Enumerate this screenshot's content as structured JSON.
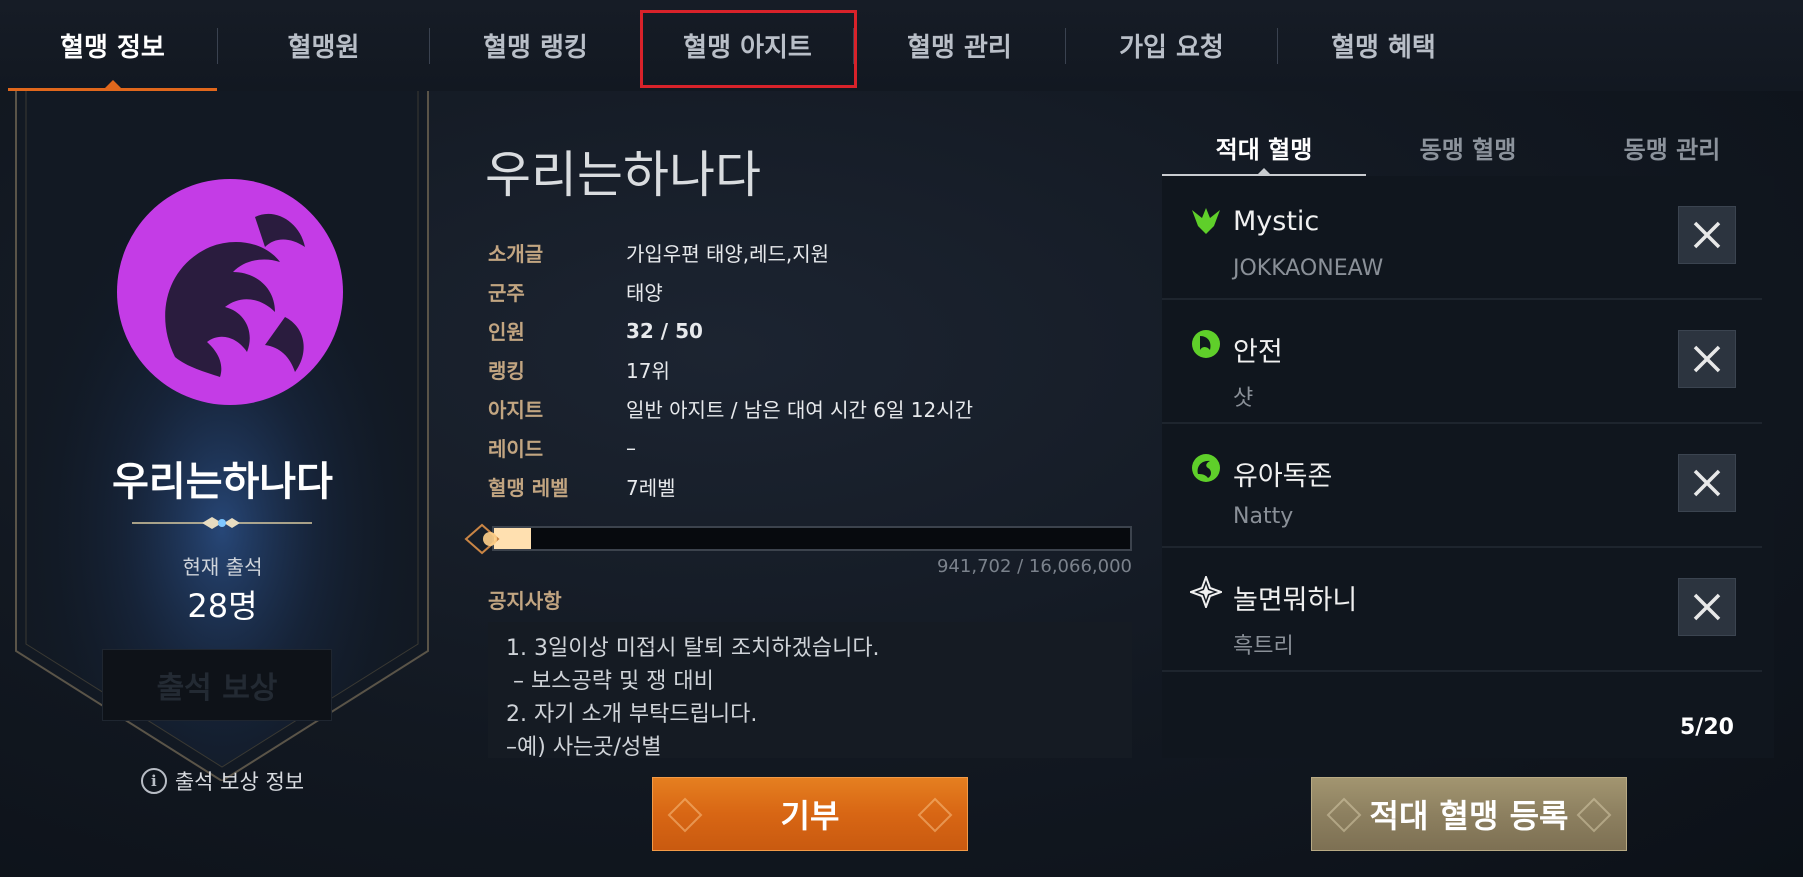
{
  "topnav": {
    "tabs": [
      {
        "label": "혈맹 정보"
      },
      {
        "label": "혈맹원"
      },
      {
        "label": "혈맹 랭킹"
      },
      {
        "label": "혈맹 아지트"
      },
      {
        "label": "혈맹 관리"
      },
      {
        "label": "가입 요청"
      },
      {
        "label": "혈맹 혜택"
      }
    ],
    "active_index": 0,
    "highlighted_index": 3
  },
  "left": {
    "guild_name": "우리는하나다",
    "attendance_label": "현재 출석",
    "attendance_count": "28명",
    "reward_button": "출석 보상",
    "reward_info": "출석 보상 정보",
    "emblem_color": "#c43ce6"
  },
  "info": {
    "title": "우리는하나다",
    "rows": [
      {
        "key": "소개글",
        "value": "가입우편 태양,레드,지원"
      },
      {
        "key": "군주",
        "value": "태양"
      },
      {
        "key": "인원",
        "value": "32 / 50"
      },
      {
        "key": "랭킹",
        "value": "17위"
      },
      {
        "key": "아지트",
        "value": "일반 아지트 / 남은 대여 시간 6일 12시간"
      },
      {
        "key": "레이드",
        "value": "–"
      },
      {
        "key": "혈맹 레벨",
        "value": "7레벨"
      }
    ],
    "exp_current": 941702,
    "exp_max": 16066000,
    "exp_text": "941,702 / 16,066,000",
    "notice_title": "공지사항",
    "notice_lines": [
      "1. 3일이상 미접시 탈퇴 조치하겠습니다.",
      " – 보스공략 및 쟁 대비",
      "2. 자기 소개 부탁드립니다.",
      "–예) 사는곳/성별"
    ]
  },
  "right": {
    "tabs": [
      {
        "label": "적대 혈맹"
      },
      {
        "label": "동맹 혈맹"
      },
      {
        "label": "동맹 관리"
      }
    ],
    "active_index": 0,
    "items": [
      {
        "name": "Mystic",
        "lord": "JOKKAONEAW",
        "icon": "green-eagle-icon"
      },
      {
        "name": "안전",
        "lord": "샷",
        "icon": "green-crest-icon"
      },
      {
        "name": "유아독존",
        "lord": "Natty",
        "icon": "green-dragon-icon"
      },
      {
        "name": "놀면뭐하니",
        "lord": "흑트리",
        "icon": "white-star-icon"
      }
    ],
    "count": "5/20"
  },
  "buttons": {
    "donate": "기부",
    "register_enemy": "적대 혈맹 등록"
  },
  "colors": {
    "accent_orange": "#e0671c",
    "highlight_red": "#d8222a",
    "label_gold": "#c2a581",
    "icon_green": "#5fcf2a"
  }
}
